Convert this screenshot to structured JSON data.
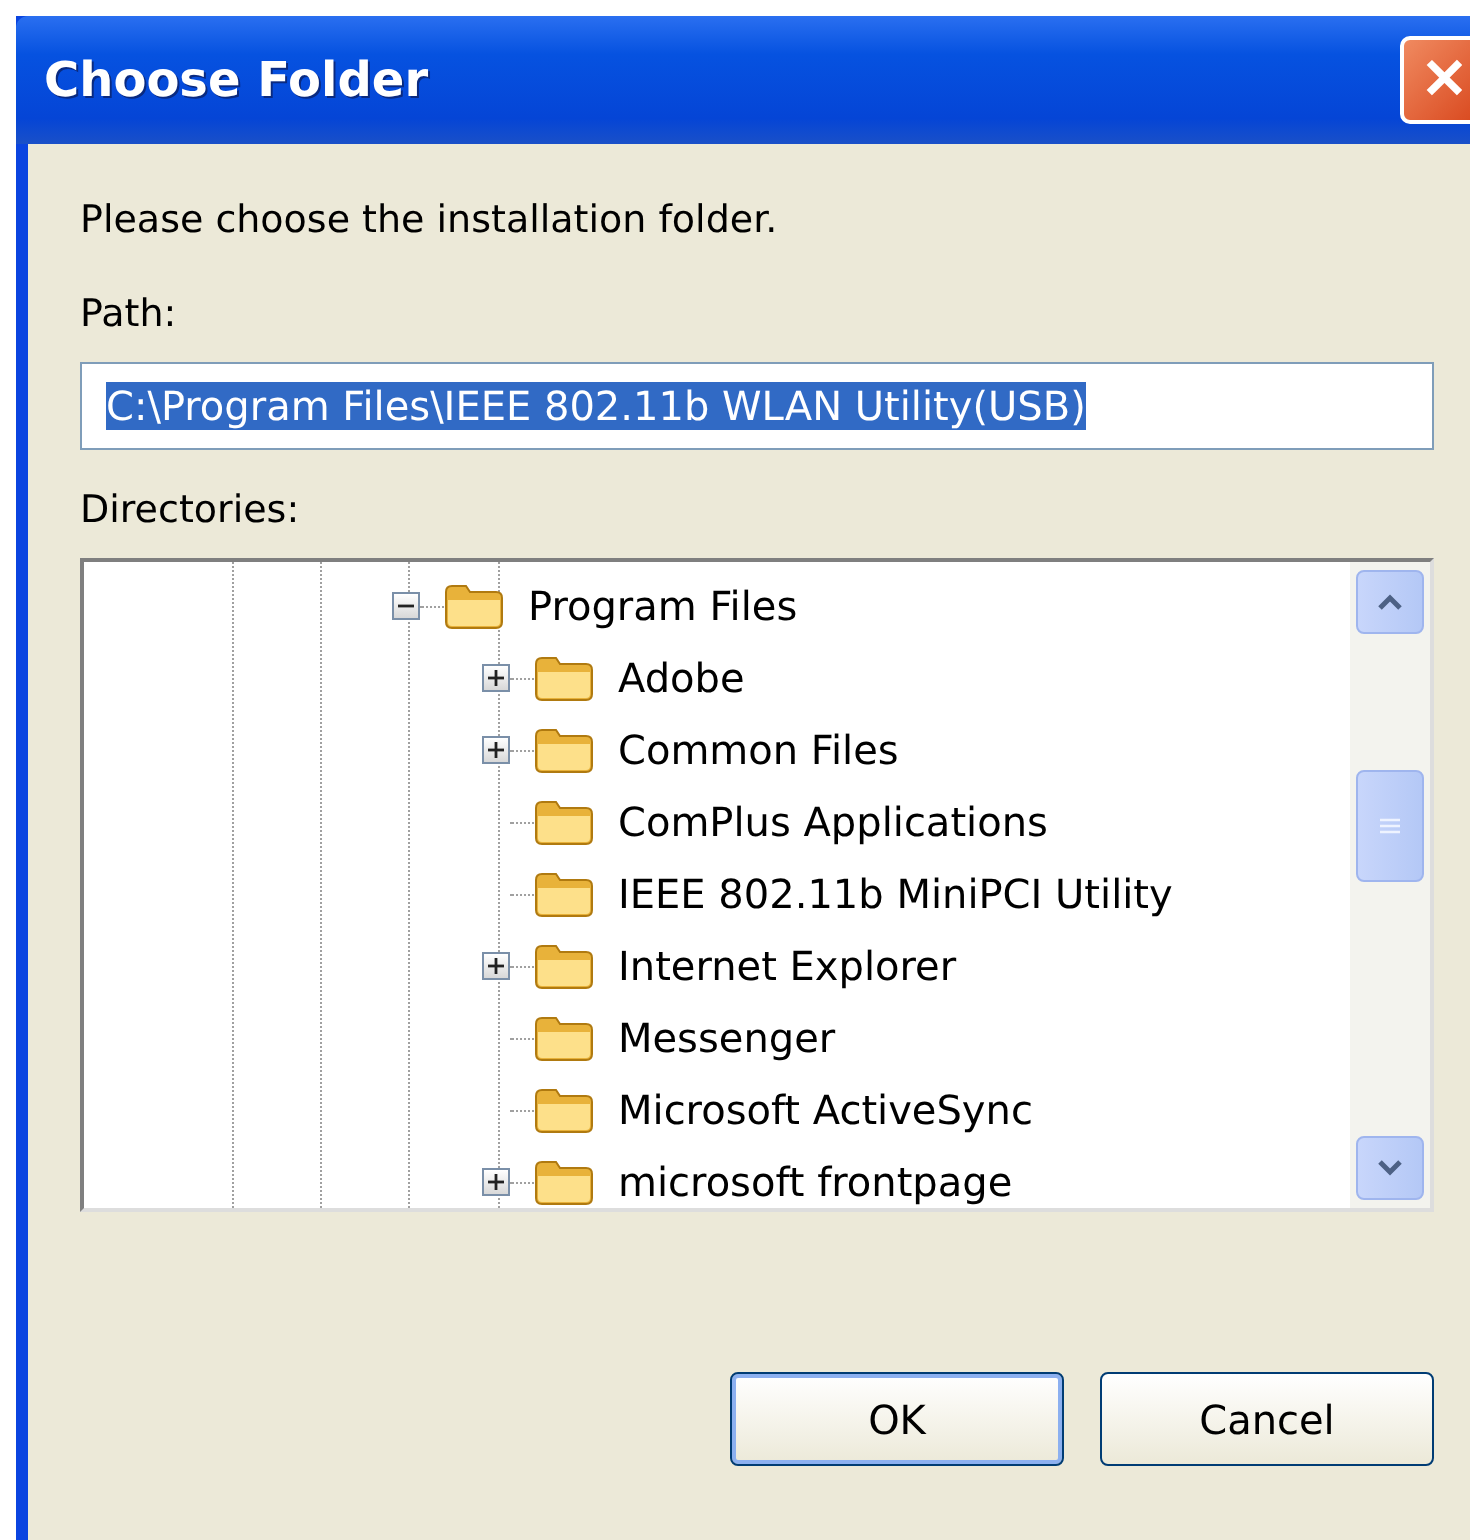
{
  "window": {
    "title": "Choose Folder",
    "close": "✕"
  },
  "prompt": "Please choose the installation folder.",
  "path": {
    "label": "Path:",
    "value": "C:\\Program Files\\IEEE 802.11b WLAN Utility(USB)",
    "value_selected": true
  },
  "directories": {
    "label": "Directories:",
    "tree": [
      {
        "name": "Program Files",
        "expanded": true,
        "children": [
          {
            "name": "Adobe",
            "has_children": true
          },
          {
            "name": "Common Files",
            "has_children": true
          },
          {
            "name": "ComPlus Applications",
            "has_children": false
          },
          {
            "name": "IEEE 802.11b MiniPCI Utility",
            "has_children": false
          },
          {
            "name": "Internet Explorer",
            "has_children": true
          },
          {
            "name": "Messenger",
            "has_children": false
          },
          {
            "name": "Microsoft ActiveSync",
            "has_children": false
          },
          {
            "name": "microsoft frontpage",
            "has_children": true
          }
        ]
      }
    ]
  },
  "buttons": [
    {
      "label": "OK",
      "default": true
    },
    {
      "label": "Cancel",
      "default": false
    }
  ]
}
